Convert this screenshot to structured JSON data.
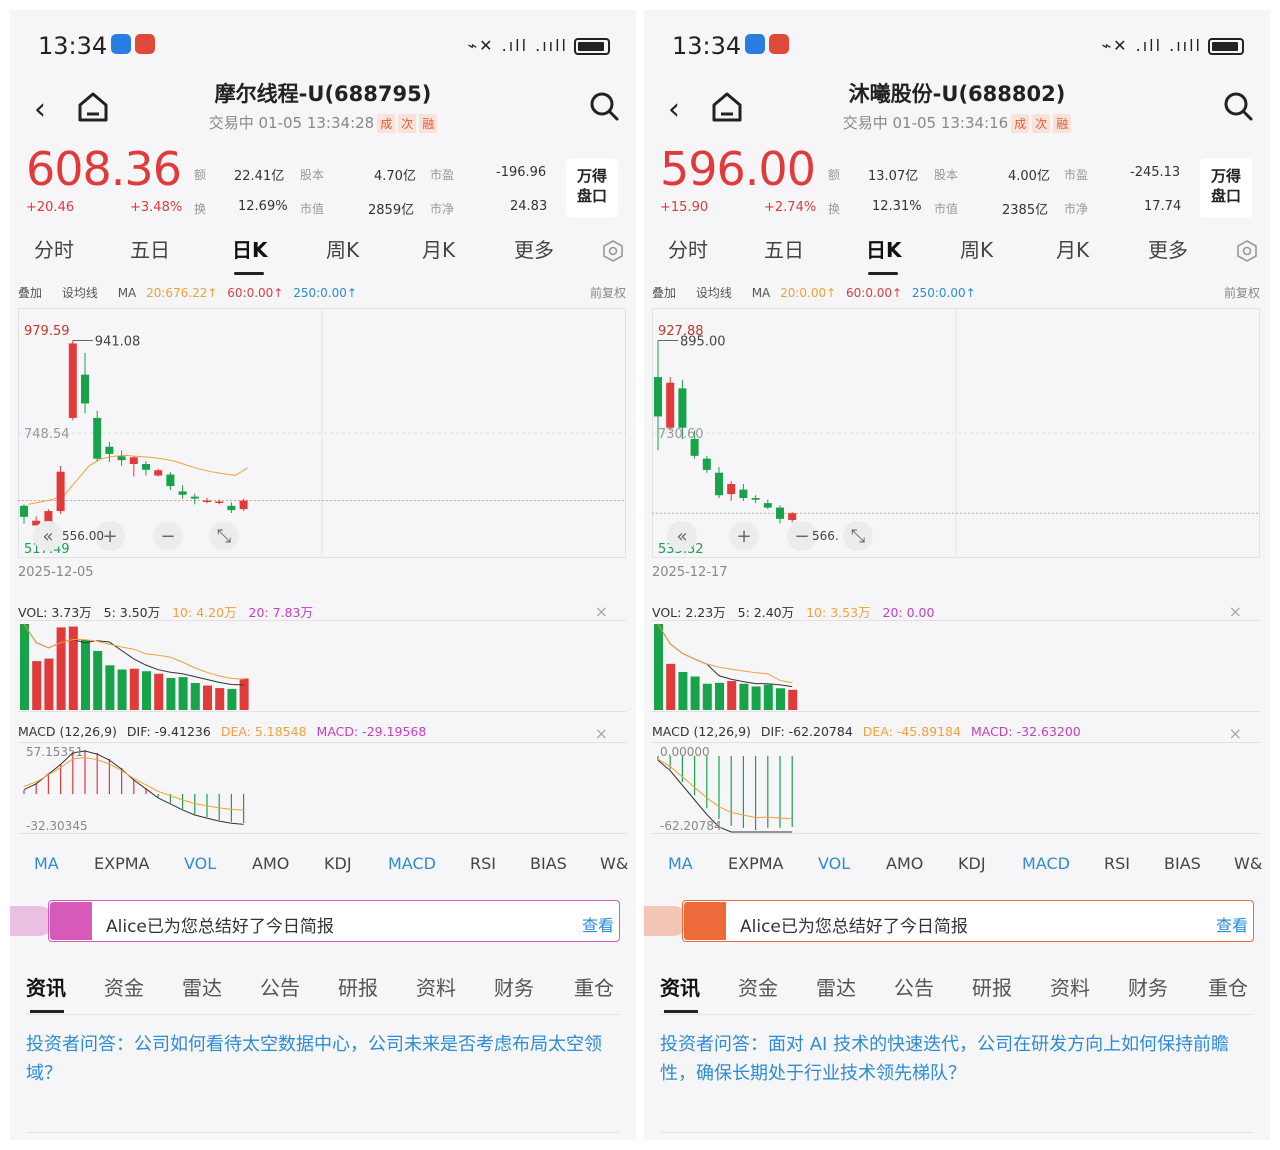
{
  "status_bar": {
    "time": "13:34",
    "signal": "⌁✕ .ıll .ııll"
  },
  "panels": [
    {
      "title": "摩尔线程-U(688795)",
      "trade_status": "交易中 01-05 13:34:28",
      "tags": [
        "成",
        "次",
        "融"
      ],
      "price": "608.36",
      "change": "+20.46",
      "change_pct": "+3.48%",
      "metrics": [
        {
          "label": "额",
          "value": "22.41亿"
        },
        {
          "label": "股本",
          "value": "4.70亿"
        },
        {
          "label": "市盈",
          "value": "-196.96"
        },
        {
          "label": "换",
          "value": "12.69%"
        },
        {
          "label": "市值",
          "value": "2859亿"
        },
        {
          "label": "市净",
          "value": "24.83"
        }
      ],
      "wind_button": "万得盘口",
      "period_tabs": [
        "分时",
        "五日",
        "日K",
        "周K",
        "月K",
        "更多"
      ],
      "ma_line": {
        "overlay": "叠加",
        "settings": "设均线",
        "ma": "MA",
        "ma20": "20:676.22↑",
        "ma60": "60:0.00↑",
        "ma250": "250:0.00↑",
        "adjust": "前复权"
      },
      "chart_data": {
        "type": "candlestick",
        "start_date": "2025-12-05",
        "y_high_label": "979.59",
        "y_mid_label": "748.54",
        "y_low_label": "517.49",
        "peak_label": "941.08",
        "low_mark_label": "556.00",
        "candles": [
          {
            "o": 597,
            "c": 574,
            "h": 600,
            "l": 560
          },
          {
            "o": 556,
            "c": 566,
            "h": 575,
            "l": 556
          },
          {
            "o": 561,
            "c": 586,
            "h": 590,
            "l": 558
          },
          {
            "o": 586,
            "c": 668,
            "h": 680,
            "l": 580
          },
          {
            "o": 780,
            "c": 935,
            "h": 941,
            "l": 775
          },
          {
            "o": 870,
            "c": 810,
            "h": 915,
            "l": 790
          },
          {
            "o": 780,
            "c": 695,
            "h": 795,
            "l": 690
          },
          {
            "o": 720,
            "c": 705,
            "h": 730,
            "l": 688
          },
          {
            "o": 700,
            "c": 692,
            "h": 712,
            "l": 680
          },
          {
            "o": 684,
            "c": 698,
            "h": 700,
            "l": 658
          },
          {
            "o": 684,
            "c": 672,
            "h": 690,
            "l": 660
          },
          {
            "o": 660,
            "c": 671,
            "h": 674,
            "l": 658
          },
          {
            "o": 662,
            "c": 638,
            "h": 667,
            "l": 630
          },
          {
            "o": 627,
            "c": 620,
            "h": 640,
            "l": 612
          },
          {
            "o": 616,
            "c": 612,
            "h": 622,
            "l": 600
          },
          {
            "o": 606,
            "c": 608,
            "h": 614,
            "l": 602
          },
          {
            "o": 604,
            "c": 606,
            "h": 610,
            "l": 600
          },
          {
            "o": 597,
            "c": 588,
            "h": 604,
            "l": 582
          },
          {
            "o": 590,
            "c": 608,
            "h": 612,
            "l": 586
          }
        ],
        "ma20_line": [
          600,
          605,
          610,
          620,
          650,
          680,
          695,
          700,
          702,
          700,
          698,
          695,
          690,
          682,
          674,
          668,
          664,
          660,
          676.22
        ]
      },
      "vol_header": {
        "vol": "VOL: 3.73万",
        "v5": "5: 3.50万",
        "v10": "10: 4.20万",
        "v20": "20: 7.83万"
      },
      "volumes": [
        10.2,
        5.8,
        6.1,
        9.8,
        9.9,
        8.3,
        7.0,
        5.3,
        4.8,
        4.9,
        4.6,
        4.3,
        3.8,
        3.9,
        3.2,
        2.9,
        2.6,
        2.5,
        3.73
      ],
      "macd_header": {
        "name": "MACD (12,26,9)",
        "dif": "DIF: -9.41236",
        "dea": "DEA: 5.18548",
        "macd": "MACD: -29.19568"
      },
      "macd_top_label": "57.15351",
      "macd_bottom_label": "-32.30345",
      "macd_hist": [
        4,
        10,
        20,
        30,
        42,
        44,
        41,
        35,
        26,
        15,
        6,
        -3,
        -9,
        -15,
        -20,
        -23,
        -26,
        -28,
        -29
      ],
      "indicator_tabs": [
        "MA",
        "EXPMA",
        "VOL",
        "AMO",
        "KDJ",
        "MACD",
        "RSI",
        "BIAS",
        "W&"
      ],
      "alice_text": "Alice已为您总结好了今日简报",
      "alice_view": "查看",
      "alice_color": "#d85ab8",
      "news_tabs": [
        "资讯",
        "资金",
        "雷达",
        "公告",
        "研报",
        "资料",
        "财务",
        "重仓"
      ],
      "news_text": "投资者问答：公司如何看待太空数据中心，公司未来是否考虑布局太空领域？"
    },
    {
      "title": "沐曦股份-U(688802)",
      "trade_status": "交易中 01-05 13:34:16",
      "tags": [
        "成",
        "次",
        "融"
      ],
      "price": "596.00",
      "change": "+15.90",
      "change_pct": "+2.74%",
      "metrics": [
        {
          "label": "额",
          "value": "13.07亿"
        },
        {
          "label": "股本",
          "value": "4.00亿"
        },
        {
          "label": "市盈",
          "value": "-245.13"
        },
        {
          "label": "换",
          "value": "12.31%"
        },
        {
          "label": "市值",
          "value": "2385亿"
        },
        {
          "label": "市净",
          "value": "17.74"
        }
      ],
      "wind_button": "万得盘口",
      "period_tabs": [
        "分时",
        "五日",
        "日K",
        "周K",
        "月K",
        "更多"
      ],
      "ma_line": {
        "overlay": "叠加",
        "settings": "设均线",
        "ma": "MA",
        "ma20": "20:0.00↑",
        "ma60": "60:0.00↑",
        "ma250": "250:0.00↑",
        "adjust": "前复权"
      },
      "chart_data": {
        "type": "candlestick",
        "start_date": "2025-12-17",
        "y_high_label": "927.88",
        "y_mid_label": "730.60",
        "y_low_label": "533.32",
        "peak_label": "895.00",
        "low_mark_label": "566.",
        "candles": [
          {
            "o": 830,
            "c": 760,
            "h": 895,
            "l": 700
          },
          {
            "o": 740,
            "c": 820,
            "h": 830,
            "l": 735
          },
          {
            "o": 810,
            "c": 740,
            "h": 825,
            "l": 720
          },
          {
            "o": 720,
            "c": 690,
            "h": 735,
            "l": 685
          },
          {
            "o": 685,
            "c": 665,
            "h": 690,
            "l": 660
          },
          {
            "o": 660,
            "c": 620,
            "h": 670,
            "l": 615
          },
          {
            "o": 622,
            "c": 640,
            "h": 645,
            "l": 610
          },
          {
            "o": 630,
            "c": 615,
            "h": 640,
            "l": 610
          },
          {
            "o": 615,
            "c": 612,
            "h": 620,
            "l": 606
          },
          {
            "o": 606,
            "c": 598,
            "h": 612,
            "l": 595
          },
          {
            "o": 598,
            "c": 578,
            "h": 602,
            "l": 570
          },
          {
            "o": 576,
            "c": 588,
            "h": 590,
            "l": 572
          }
        ]
      },
      "vol_header": {
        "vol": "VOL: 2.23万",
        "v5": "5: 2.40万",
        "v10": "10: 3.53万",
        "v20": "20: 0.00"
      },
      "volumes": [
        9.5,
        5.1,
        4.2,
        3.7,
        2.9,
        3.0,
        3.2,
        2.9,
        2.6,
        2.8,
        2.4,
        2.23
      ],
      "macd_header": {
        "name": "MACD (12,26,9)",
        "dif": "DIF: -62.20784",
        "dea": "DEA: -45.89184",
        "macd": "MACD: -32.63200"
      },
      "macd_top_label": "0.00000",
      "macd_bottom_label": "-62.20784",
      "macd_hist": [
        -2,
        -6,
        -12,
        -18,
        -24,
        -29,
        -32,
        -33,
        -34,
        -33,
        -33,
        -32.6
      ],
      "indicator_tabs": [
        "MA",
        "EXPMA",
        "VOL",
        "AMO",
        "KDJ",
        "MACD",
        "RSI",
        "BIAS",
        "W&"
      ],
      "alice_text": "Alice已为您总结好了今日简报",
      "alice_view": "查看",
      "alice_color": "#ef6a3a",
      "news_tabs": [
        "资讯",
        "资金",
        "雷达",
        "公告",
        "研报",
        "资料",
        "财务",
        "重仓"
      ],
      "news_text": "投资者问答：面对 AI 技术的快速迭代，公司在研发方向上如何保持前瞻性，确保长期处于行业技术领先梯队？"
    }
  ]
}
